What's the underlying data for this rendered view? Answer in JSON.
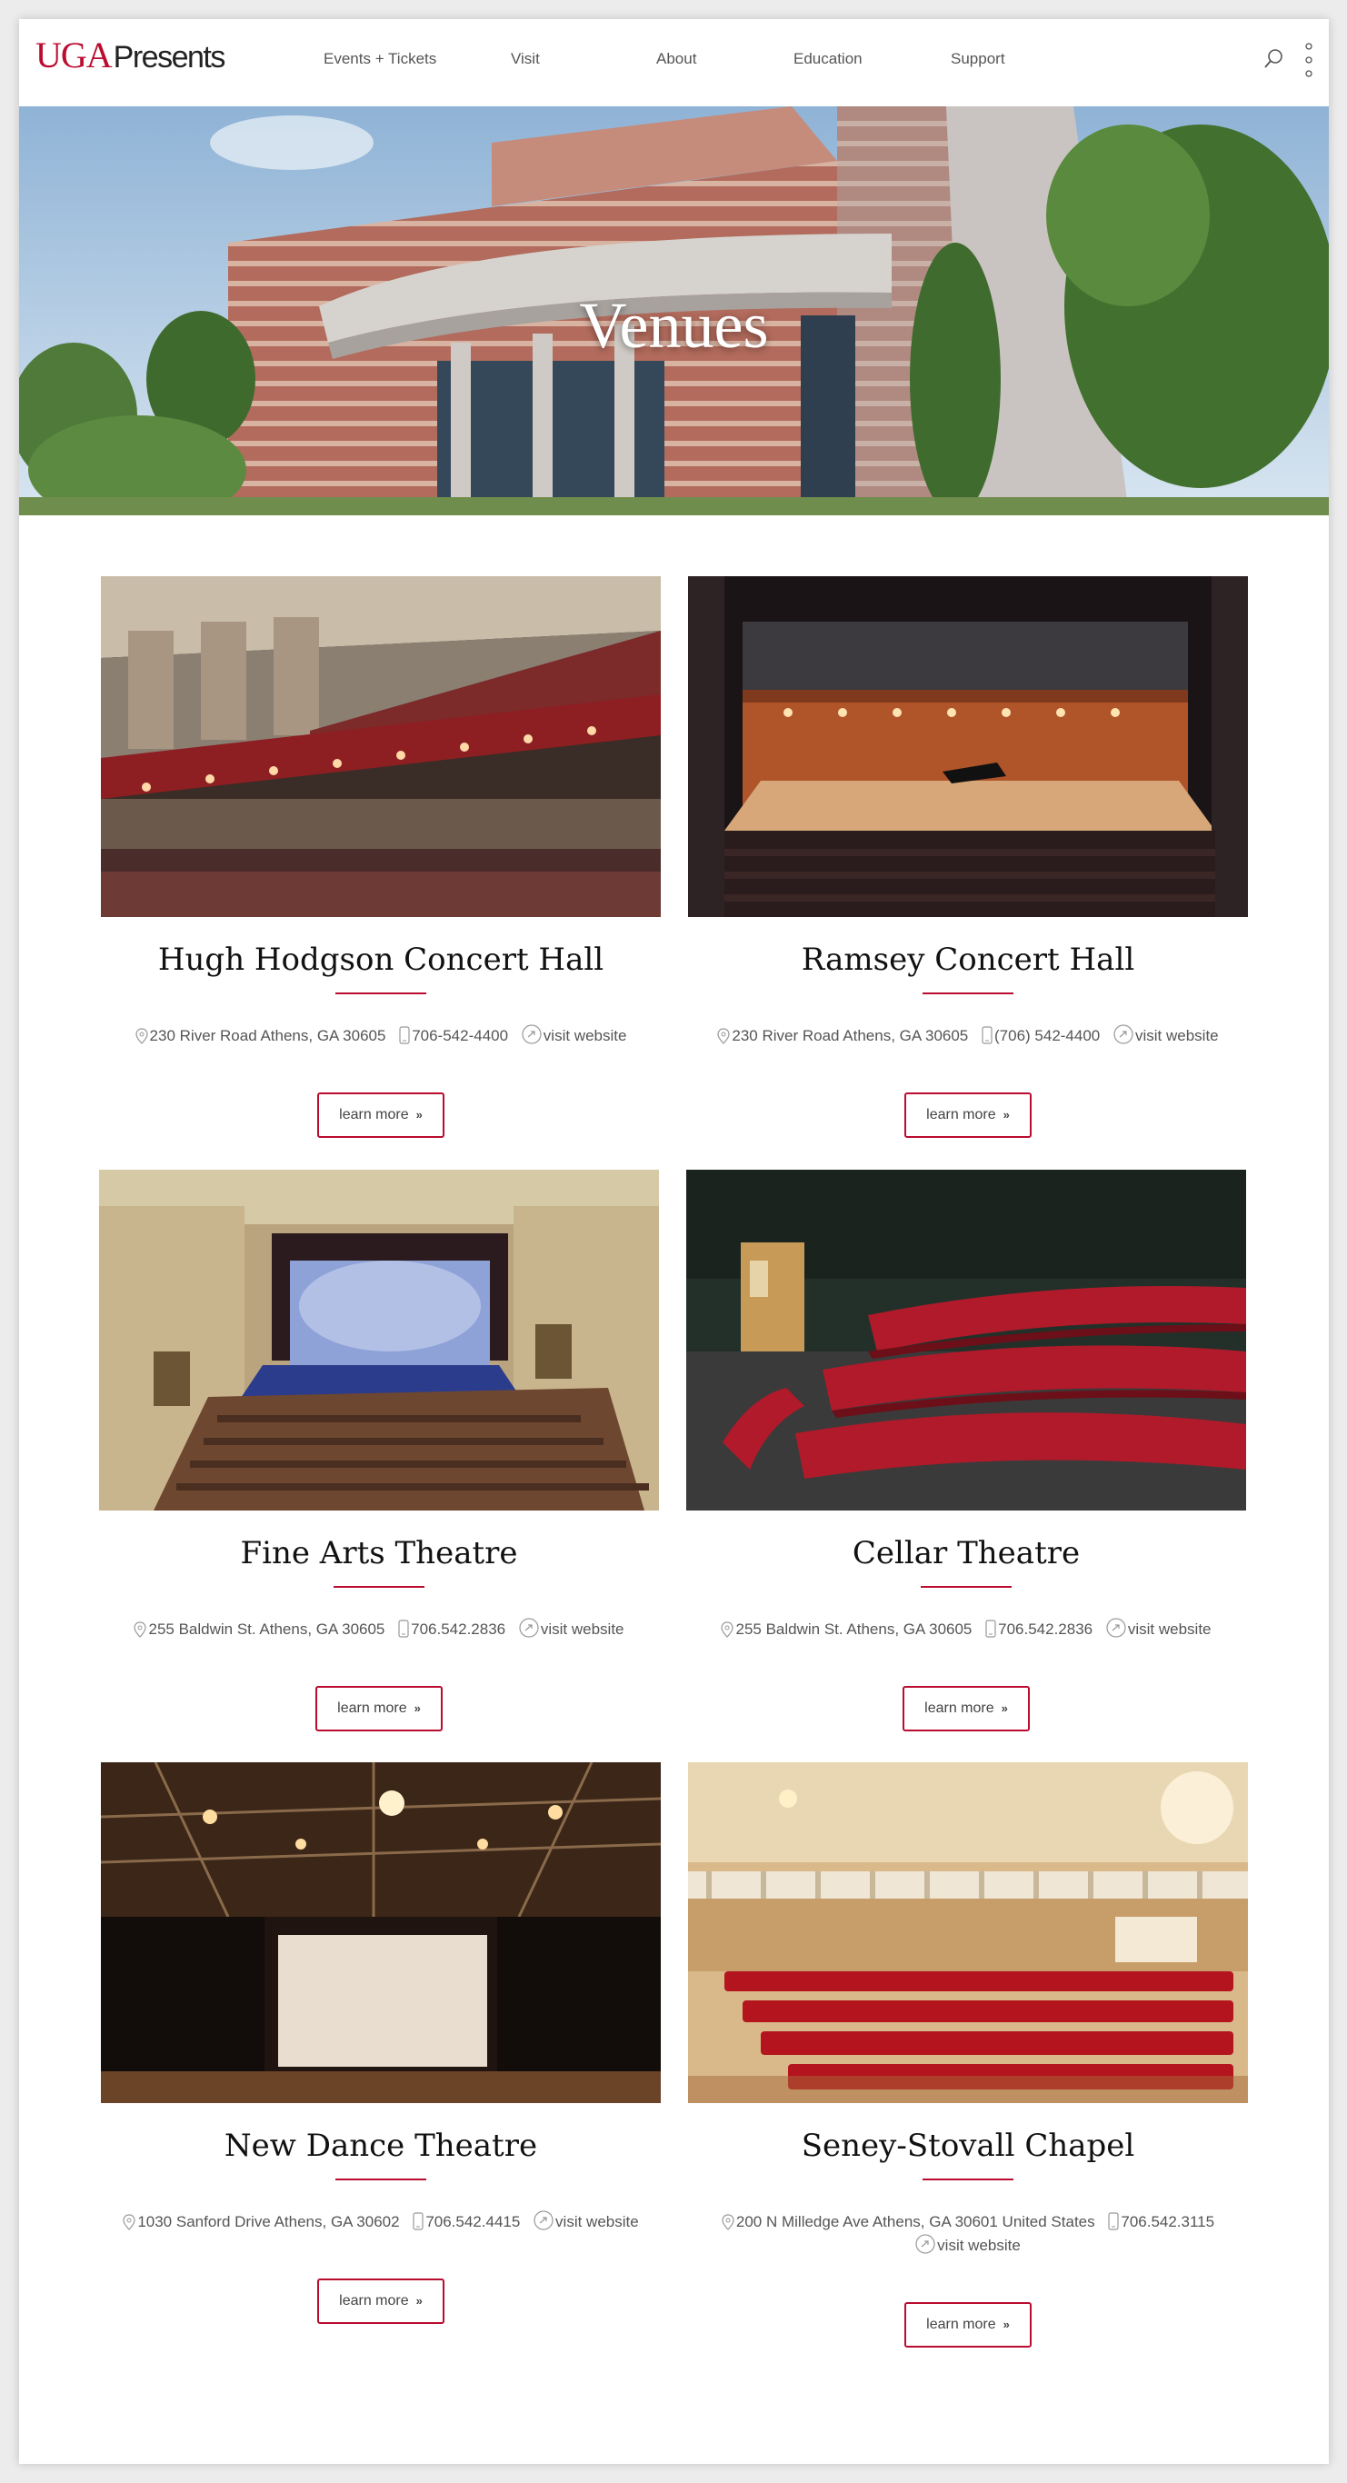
{
  "header": {
    "logo_primary": "UGA",
    "logo_secondary": "Presents",
    "nav": [
      "Events + Tickets",
      "Visit",
      "About",
      "Education",
      "Support"
    ]
  },
  "hero": {
    "title": "Venues"
  },
  "colors": {
    "accent": "#ba0c2f",
    "text": "#333333",
    "background": "#ffffff"
  },
  "venues": [
    {
      "name": "Hugh Hodgson Concert Hall",
      "address": "230 River Road Athens, GA 30605",
      "phone": "706-542-4400",
      "website": "visit website",
      "button": "learn more"
    },
    {
      "name": "Ramsey Concert Hall",
      "address": "230 River Road Athens, GA 30605",
      "phone": "(706) 542-4400",
      "website": "visit website",
      "button": "learn more"
    },
    {
      "name": "Fine Arts Theatre",
      "address": "255 Baldwin St. Athens, GA 30605",
      "phone": "706.542.2836",
      "website": "visit website",
      "button": "learn more"
    },
    {
      "name": "Cellar Theatre",
      "address": "255 Baldwin St. Athens, GA 30605",
      "phone": "706.542.2836",
      "website": "visit website",
      "button": "learn more"
    },
    {
      "name": "New Dance Theatre",
      "address": "1030 Sanford Drive Athens, GA 30602",
      "phone": "706.542.4415",
      "website": "visit website",
      "button": "learn more"
    },
    {
      "name": "Seney-Stovall Chapel",
      "address": "200 N Milledge Ave Athens, GA 30601 United States",
      "phone": "706.542.3115",
      "website": "visit website",
      "button": "learn more"
    }
  ]
}
